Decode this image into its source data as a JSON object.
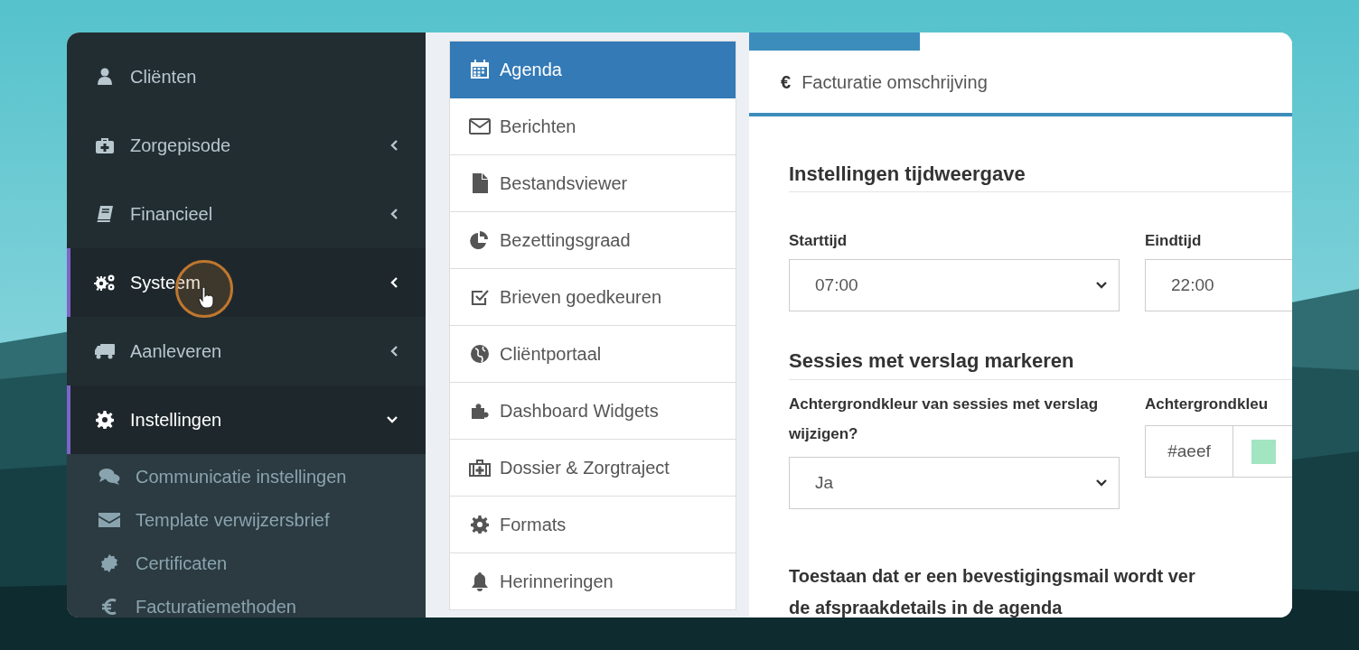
{
  "sidebar": {
    "items": [
      {
        "label": "Cliënten",
        "active": false
      },
      {
        "label": "Zorgepisode",
        "active": false,
        "expanded": false
      },
      {
        "label": "Financieel",
        "active": false,
        "expanded": false
      },
      {
        "label": "Systeem",
        "active": true,
        "expanded": false
      },
      {
        "label": "Aanleveren",
        "active": false,
        "expanded": false
      },
      {
        "label": "Instellingen",
        "active": true,
        "expanded": true,
        "children": [
          {
            "label": "Communicatie instellingen"
          },
          {
            "label": "Template verwijzersbrief"
          },
          {
            "label": "Certificaten"
          },
          {
            "label": "Facturatiemethoden"
          }
        ]
      }
    ]
  },
  "settings_menu": {
    "items": [
      {
        "label": "Agenda",
        "selected": true
      },
      {
        "label": "Berichten",
        "selected": false
      },
      {
        "label": "Bestandsviewer",
        "selected": false
      },
      {
        "label": "Bezettingsgraad",
        "selected": false
      },
      {
        "label": "Brieven goedkeuren",
        "selected": false
      },
      {
        "label": "Cliëntportaal",
        "selected": false
      },
      {
        "label": "Dashboard Widgets",
        "selected": false
      },
      {
        "label": "Dossier & Zorgtraject",
        "selected": false
      },
      {
        "label": "Formats",
        "selected": false
      },
      {
        "label": "Herinneringen",
        "selected": false
      }
    ]
  },
  "panel": {
    "header": {
      "icon": "€",
      "label": "Facturatie omschrijving"
    },
    "sections": [
      {
        "title": "Instellingen tijdweergave",
        "fields": [
          {
            "label": "Starttijd",
            "kind": "select",
            "value": "07:00"
          },
          {
            "label": "Eindtijd",
            "kind": "text",
            "value": "22:00"
          }
        ]
      },
      {
        "title": "Sessies met verslag markeren",
        "fields": [
          {
            "label": "Achtergrondkleur van sessies met verslag wijzigen?",
            "kind": "select",
            "value": "Ja"
          },
          {
            "label": "Achtergrondkleu",
            "kind": "color",
            "value": "#aeef",
            "color": "#a3e4c1"
          }
        ]
      }
    ],
    "confirmation_heading": [
      "Toestaan dat er een bevestigingsmail wordt ver",
      "de afspraakdetails in de agenda"
    ]
  }
}
